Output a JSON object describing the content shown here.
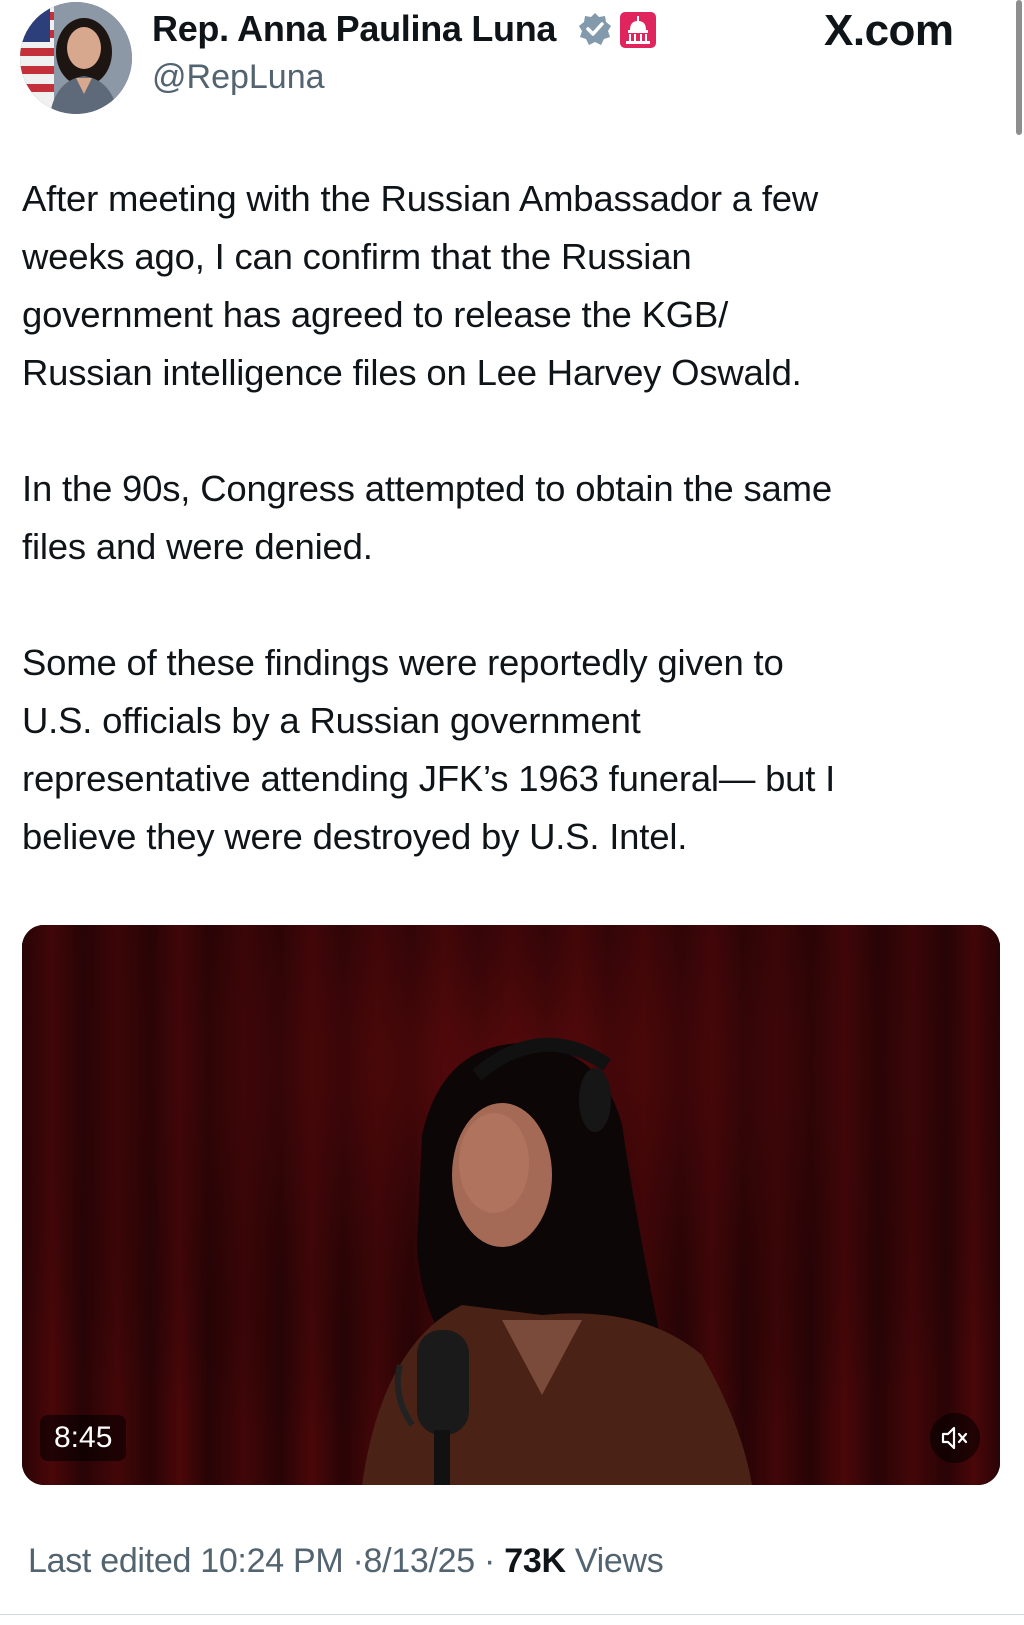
{
  "header": {
    "display_name": "Rep. Anna Paulina Luna",
    "handle": "@RepLuna",
    "verified_icon": "verified-badge-icon",
    "affiliation_icon": "us-capitol-badge-icon",
    "site_watermark": "X.com"
  },
  "tweet": {
    "paragraphs": [
      "After meeting with the Russian Ambassador a few\nweeks ago, I can confirm that the Russian\ngovernment has agreed to release the KGB/\nRussian intelligence files on Lee Harvey Oswald.",
      "In the 90s, Congress attempted to obtain the same\nfiles and were denied.",
      "Some of these findings were reportedly given to\nU.S. officials by a Russian government\nrepresentative attending JFK’s 1963 funeral— but I\nbelieve they were destroyed by U.S. Intel."
    ]
  },
  "video": {
    "duration": "8:45",
    "mute_icon": "speaker-muted-icon"
  },
  "meta": {
    "edited_prefix": "Last edited",
    "time": "10:24 PM",
    "separator": "·",
    "date": "8/13/25",
    "views_count": "73K",
    "views_label": "Views"
  },
  "colors": {
    "text_primary": "#0f1419",
    "text_secondary": "#536471",
    "verified_blue": "#829aab",
    "gov_red": "#e0245e"
  }
}
